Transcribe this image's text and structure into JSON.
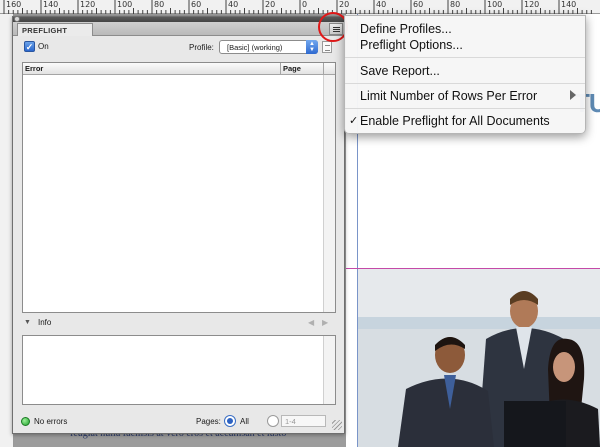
{
  "ruler": {
    "ticks": [
      "160",
      "140",
      "120",
      "100",
      "80",
      "60",
      "40",
      "20",
      "0",
      "20",
      "40",
      "60",
      "80",
      "100",
      "120",
      "140"
    ]
  },
  "panel": {
    "tab_title": "PREFLIGHT",
    "on_label": "On",
    "profile_label": "Profile:",
    "profile_value": "[Basic] (working)",
    "error_column": "Error",
    "page_column": "Page",
    "info_label": "Info",
    "status_text": "No errors",
    "pages_label": "Pages:",
    "all_label": "All",
    "range_value": "1-4"
  },
  "menu": {
    "items": [
      {
        "label": "Define Profiles..."
      },
      {
        "label": "Preflight Options..."
      },
      {
        "label": "Save Report..."
      },
      {
        "label": "Limit Number of Rows Per Error"
      },
      {
        "label": "Enable Preflight for All Documents"
      }
    ],
    "checkmark": "✓"
  },
  "document": {
    "logo_text": "TU",
    "body_text": "feugiat nulla facilisis at vero eros et accumsan et iusto"
  },
  "colors": {
    "status_ok": "#1ea12a",
    "accent": "#2c62c2",
    "highlight_circle": "#e01818"
  }
}
